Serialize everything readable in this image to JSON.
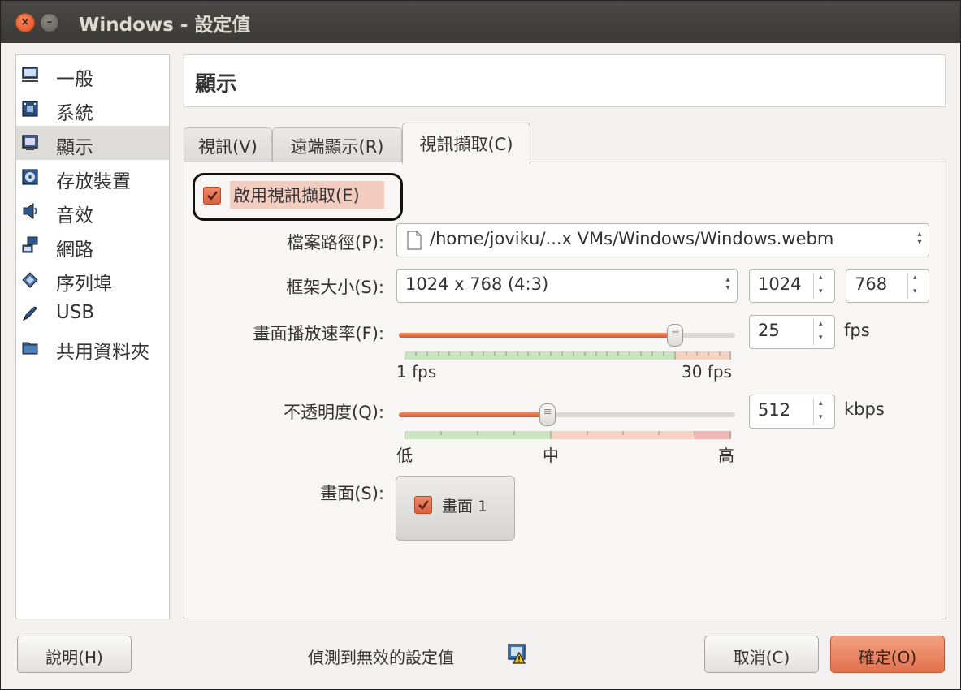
{
  "window": {
    "title": "Windows - 設定值",
    "close_glyph": "×",
    "minimize_glyph": "–"
  },
  "sidebar": {
    "items": [
      {
        "label": "一般",
        "icon": "monitor-icon",
        "selected": false
      },
      {
        "label": "系統",
        "icon": "chip-icon",
        "selected": false
      },
      {
        "label": "顯示",
        "icon": "display-icon",
        "selected": true
      },
      {
        "label": "存放裝置",
        "icon": "disk-icon",
        "selected": false
      },
      {
        "label": "音效",
        "icon": "speaker-icon",
        "selected": false
      },
      {
        "label": "網路",
        "icon": "network-icon",
        "selected": false
      },
      {
        "label": "序列埠",
        "icon": "serial-port-icon",
        "selected": false
      },
      {
        "label": "USB",
        "icon": "usb-icon",
        "selected": false
      },
      {
        "label": "共用資料夾",
        "icon": "folder-icon",
        "selected": false
      }
    ]
  },
  "header": {
    "title": "顯示"
  },
  "tabs": [
    {
      "label": "視訊(V)",
      "active": false
    },
    {
      "label": "遠端顯示(R)",
      "active": false
    },
    {
      "label": "視訊擷取(C)",
      "active": true
    }
  ],
  "capture": {
    "enable_label": "啟用視訊擷取(E)",
    "enable_checked": true,
    "file_path_label": "檔案路徑(P):",
    "file_path_value": "/home/joviku/...x VMs/Windows/Windows.webm",
    "frame_size_label": "框架大小(S):",
    "frame_size_value": "1024 x 768 (4:3)",
    "frame_width": "1024",
    "frame_height": "768",
    "fps_label": "畫面播放速率(F):",
    "fps_value": "25",
    "fps_unit": "fps",
    "fps_min_label": "1 fps",
    "fps_max_label": "30 fps",
    "fps_slider_fraction": 0.82,
    "quality_label": "不透明度(Q):",
    "quality_value": "512",
    "quality_unit": "kbps",
    "quality_low_label": "低",
    "quality_mid_label": "中",
    "quality_high_label": "高",
    "quality_slider_fraction": 0.44,
    "screens_label": "畫面(S):",
    "screen_item_label": "畫面 1",
    "screen_item_checked": true
  },
  "footer": {
    "help_button": "說明(H)",
    "status_text": "偵測到無效的設定值",
    "status_icon": "warning-icon",
    "cancel_button": "取消(C)",
    "ok_button": "確定(O)"
  },
  "colors": {
    "accent": "#e2714d",
    "titlebar": "#3c3b37",
    "highlight": "#f3ccc0"
  }
}
